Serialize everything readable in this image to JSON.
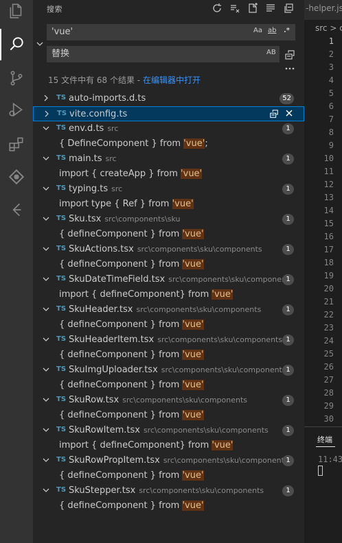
{
  "sidebar": {
    "title": "搜索",
    "search_value": "'vue'",
    "replace_placeholder": "替换",
    "search_options": {
      "match_case": "Aa",
      "whole_word": "ab",
      "regex": ".*"
    },
    "replace_option": "AB",
    "summary_prefix": "15 文件中有 68 个结果 - ",
    "summary_link": "在编辑器中打开"
  },
  "results": [
    {
      "file": "auto-imports.d.ts",
      "path": "",
      "count": "52",
      "collapsed": true,
      "lines": []
    },
    {
      "file": "vite.config.ts",
      "path": "",
      "count": "",
      "collapsed": true,
      "selected": true,
      "lines": []
    },
    {
      "file": "env.d.ts",
      "path": "src",
      "count": "1",
      "lines": [
        {
          "before": "{ DefineComponent } from ",
          "match": "'vue'",
          "after": ";"
        }
      ]
    },
    {
      "file": "main.ts",
      "path": "src",
      "count": "1",
      "lines": [
        {
          "before": "import { createApp } from ",
          "match": "'vue'",
          "after": ""
        }
      ]
    },
    {
      "file": "typing.ts",
      "path": "src",
      "count": "1",
      "lines": [
        {
          "before": "import type { Ref } from ",
          "match": "'vue'",
          "after": ""
        }
      ]
    },
    {
      "file": "Sku.tsx",
      "path": "src\\components\\sku",
      "count": "1",
      "lines": [
        {
          "before": "{ defineComponent } from ",
          "match": "'vue'",
          "after": ""
        }
      ]
    },
    {
      "file": "SkuActions.tsx",
      "path": "src\\components\\sku\\components",
      "count": "1",
      "lines": [
        {
          "before": "{ defineComponent  } from ",
          "match": "'vue'",
          "after": ""
        }
      ]
    },
    {
      "file": "SkuDateTimeField.tsx",
      "path": "src\\components\\sku\\components",
      "count": "1",
      "lines": [
        {
          "before": "import { defineComponent} from ",
          "match": "'vue'",
          "after": ""
        }
      ]
    },
    {
      "file": "SkuHeader.tsx",
      "path": "src\\components\\sku\\components",
      "count": "1",
      "lines": [
        {
          "before": "{ defineComponent  } from ",
          "match": "'vue'",
          "after": ""
        }
      ]
    },
    {
      "file": "SkuHeaderItem.tsx",
      "path": "src\\components\\sku\\components",
      "count": "1",
      "lines": [
        {
          "before": "{ defineComponent  } from ",
          "match": "'vue'",
          "after": ""
        }
      ]
    },
    {
      "file": "SkuImgUploader.tsx",
      "path": "src\\components\\sku\\components",
      "count": "1",
      "lines": [
        {
          "before": "{ defineComponent  } from ",
          "match": "'vue'",
          "after": ""
        }
      ]
    },
    {
      "file": "SkuRow.tsx",
      "path": "src\\components\\sku\\components",
      "count": "1",
      "lines": [
        {
          "before": "{ defineComponent  } from ",
          "match": "'vue'",
          "after": ""
        }
      ]
    },
    {
      "file": "SkuRowItem.tsx",
      "path": "src\\components\\sku\\components",
      "count": "1",
      "lines": [
        {
          "before": "import { defineComponent} from ",
          "match": "'vue'",
          "after": ""
        }
      ]
    },
    {
      "file": "SkuRowPropItem.tsx",
      "path": "src\\components\\sku\\components",
      "count": "1",
      "lines": [
        {
          "before": "{ defineComponent  } from ",
          "match": "'vue'",
          "after": ""
        }
      ]
    },
    {
      "file": "SkuStepper.tsx",
      "path": "src\\components\\sku\\components",
      "count": "1",
      "lines": [
        {
          "before": "{ defineComponent  } from ",
          "match": "'vue'",
          "after": ""
        }
      ]
    }
  ],
  "file_type_label": "TS",
  "editor": {
    "tab_label": "-helper.js",
    "breadcrumb": "src > c",
    "line_numbers": [
      "1",
      "2",
      "3",
      "4",
      "5",
      "6",
      "7",
      "8",
      "9",
      "10",
      "11",
      "12",
      "13",
      "14",
      "15",
      "16",
      "17",
      "18",
      "19",
      "20",
      "21",
      "22",
      "23",
      "24",
      "25",
      "26",
      "27",
      "28",
      "29",
      "30"
    ],
    "current_line": "1",
    "panel_tab": "终端",
    "terminal_time": "11:43"
  },
  "colors": {
    "accent": "#007fd4",
    "match_bg": "#613214",
    "ts_blue": "#519aba",
    "link": "#3794ff"
  },
  "icons": [
    "explorer-icon",
    "search-icon",
    "source-control-icon",
    "run-debug-icon",
    "extensions-icon",
    "gitlens-icon",
    "timeline-icon",
    "refresh-icon",
    "clear-results-icon",
    "new-search-editor-icon",
    "collapse-all-icon",
    "view-as-tree-icon",
    "replace-all-icon"
  ]
}
